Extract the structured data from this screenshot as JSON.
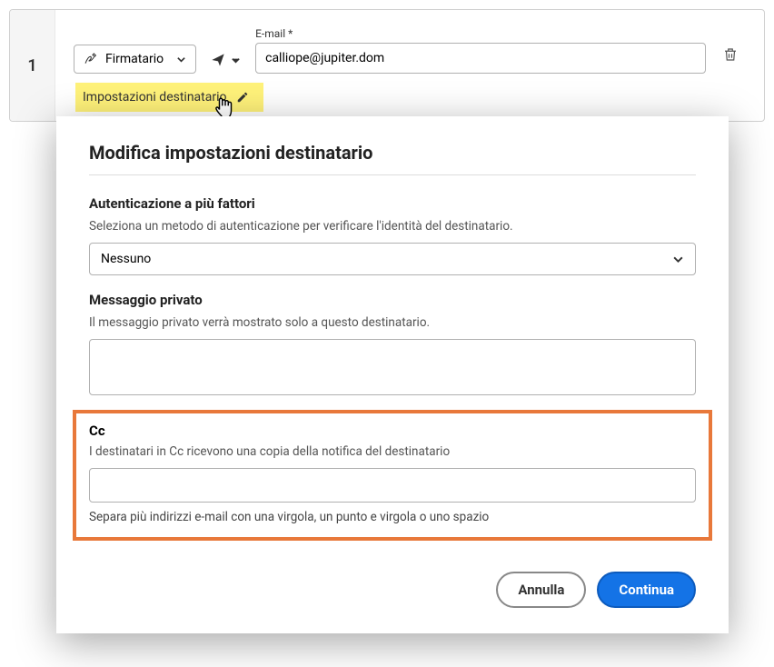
{
  "recipient": {
    "number": "1",
    "role_label": "Firmatario",
    "email_label": "E-mail *",
    "email_value": "calliope@jupiter.dom",
    "settings_link": "Impostazioni destinatario"
  },
  "modal": {
    "title": "Modifica impostazioni destinatario",
    "mfa": {
      "heading": "Autenticazione a più fattori",
      "desc": "Seleziona un metodo di autenticazione per verificare l'identità del destinatario.",
      "selected": "Nessuno"
    },
    "private_msg": {
      "heading": "Messaggio privato",
      "desc": "Il messaggio privato verrà mostrato solo a questo destinatario.",
      "value": ""
    },
    "cc": {
      "heading": "Cc",
      "desc": "I destinatari in Cc ricevono una copia della notifica del destinatario",
      "value": "",
      "hint": "Separa più indirizzi e-mail con una virgola, un punto e virgola o uno spazio"
    },
    "actions": {
      "cancel": "Annulla",
      "continue": "Continua"
    }
  }
}
